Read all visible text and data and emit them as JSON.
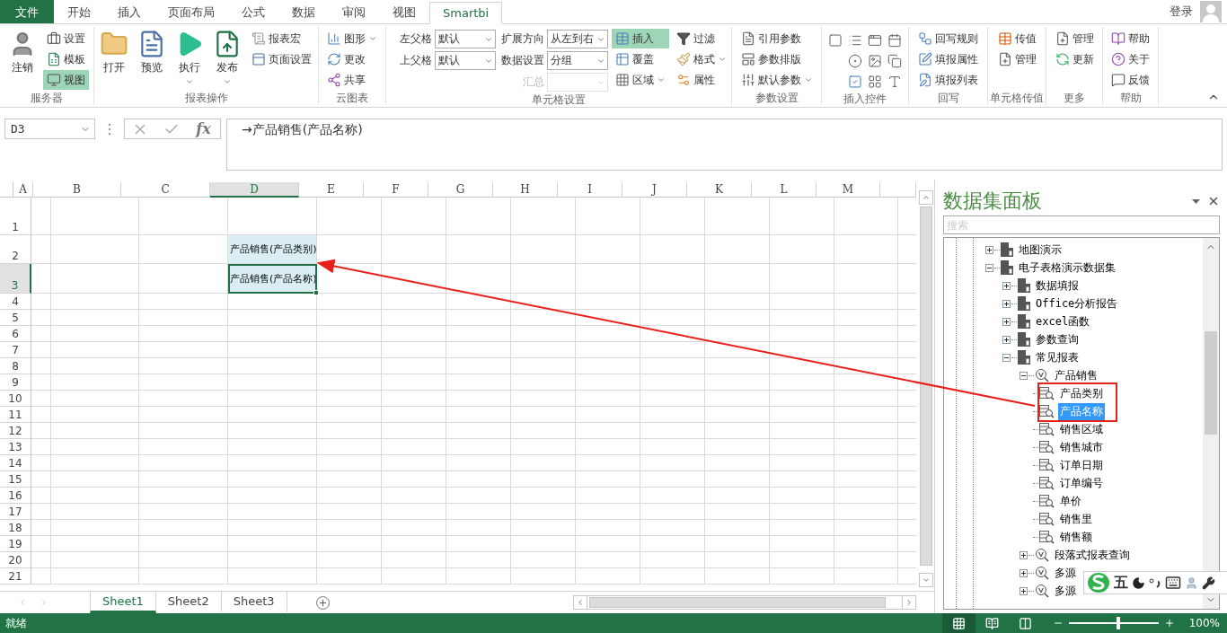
{
  "menu_tabs": [
    {
      "label": "文件",
      "kind": "file",
      "selected": false
    },
    {
      "label": "开始",
      "kind": "tab",
      "selected": false
    },
    {
      "label": "插入",
      "kind": "tab",
      "selected": false
    },
    {
      "label": "页面布局",
      "kind": "tab",
      "selected": false
    },
    {
      "label": "公式",
      "kind": "tab",
      "selected": false
    },
    {
      "label": "数据",
      "kind": "tab",
      "selected": false
    },
    {
      "label": "审阅",
      "kind": "tab",
      "selected": false
    },
    {
      "label": "视图",
      "kind": "tab",
      "selected": false
    },
    {
      "label": "Smartbi",
      "kind": "tab",
      "selected": true
    }
  ],
  "account": {
    "label": "登录"
  },
  "ribbon_groups": [
    {
      "label": "服务器",
      "items": [
        {
          "kind": "large",
          "label": "注销",
          "dropdown": false
        },
        {
          "kind": "small_column",
          "buttons": [
            {
              "label": "设置",
              "on": false,
              "dropdown": false
            },
            {
              "label": "模板",
              "on": false,
              "dropdown": false
            },
            {
              "label": "视图",
              "on": true,
              "dropdown": false
            }
          ]
        }
      ]
    },
    {
      "label": "报表操作",
      "items": [
        {
          "kind": "large",
          "label": "打开",
          "dropdown": false
        },
        {
          "kind": "large",
          "label": "预览",
          "dropdown": false
        },
        {
          "kind": "large",
          "label": "执行",
          "dropdown": true
        },
        {
          "kind": "large",
          "label": "发布",
          "dropdown": true
        },
        {
          "kind": "small_column",
          "buttons": [
            {
              "label": "报表宏",
              "on": false,
              "dropdown": false
            },
            {
              "label": "页面设置",
              "on": false,
              "dropdown": false
            }
          ]
        }
      ]
    },
    {
      "label": "云图表",
      "items": [
        {
          "kind": "small_column",
          "buttons": [
            {
              "label": "图形",
              "on": false,
              "dropdown": true
            },
            {
              "label": "更改",
              "on": false,
              "dropdown": false
            },
            {
              "label": "共享",
              "on": false,
              "dropdown": false
            }
          ]
        }
      ]
    },
    {
      "label": "单元格设置",
      "items": [
        {
          "kind": "field_column",
          "fields": [
            {
              "label": "左父格",
              "value": "默认",
              "disabled": false
            },
            {
              "label": "上父格",
              "value": "默认",
              "disabled": false
            }
          ]
        },
        {
          "kind": "field_column",
          "fields": [
            {
              "label": "扩展方向",
              "value": "从左到右",
              "disabled": false
            },
            {
              "label": "数据设置",
              "value": "分组",
              "disabled": false
            },
            {
              "label": "汇总",
              "disabled": true
            }
          ]
        },
        {
          "kind": "small_column",
          "buttons": [
            {
              "label": "插入",
              "on": true,
              "dropdown": false
            },
            {
              "label": "覆盖",
              "on": false,
              "dropdown": false
            },
            {
              "label": "区域",
              "on": false,
              "dropdown": true
            }
          ]
        },
        {
          "kind": "small_column",
          "buttons": [
            {
              "label": "过滤",
              "on": false,
              "dropdown": false
            },
            {
              "label": "格式",
              "on": false,
              "dropdown": true
            },
            {
              "label": "属性",
              "on": false,
              "dropdown": false
            }
          ]
        }
      ]
    },
    {
      "label": "参数设置",
      "items": [
        {
          "kind": "small_column",
          "buttons": [
            {
              "label": "引用参数",
              "on": false,
              "dropdown": false
            },
            {
              "label": "参数排版",
              "on": false,
              "dropdown": false
            },
            {
              "label": "默认参数",
              "on": false,
              "dropdown": true
            }
          ]
        }
      ]
    },
    {
      "label": "插入控件",
      "items": [
        {
          "kind": "icon_grid"
        }
      ]
    },
    {
      "label": "回写",
      "items": [
        {
          "kind": "small_column",
          "buttons": [
            {
              "label": "回写规则",
              "on": false,
              "dropdown": false
            },
            {
              "label": "填报属性",
              "on": false,
              "dropdown": false
            },
            {
              "label": "填报列表",
              "on": false,
              "dropdown": false
            }
          ]
        }
      ]
    },
    {
      "label": "单元格传值",
      "items": [
        {
          "kind": "small_column",
          "buttons": [
            {
              "label": "传值",
              "on": false,
              "dropdown": false
            },
            {
              "label": "管理",
              "on": false,
              "dropdown": false
            }
          ]
        }
      ]
    },
    {
      "label": "更多",
      "items": [
        {
          "kind": "small_column",
          "buttons": [
            {
              "label": "管理",
              "on": false,
              "dropdown": false
            },
            {
              "label": "更新",
              "on": false,
              "dropdown": false
            }
          ]
        }
      ]
    },
    {
      "label": "帮助",
      "items": [
        {
          "kind": "small_column",
          "buttons": [
            {
              "label": "帮助",
              "on": false,
              "dropdown": false
            },
            {
              "label": "关于",
              "on": false,
              "dropdown": false
            },
            {
              "label": "反馈",
              "on": false,
              "dropdown": false
            }
          ]
        }
      ]
    }
  ],
  "formula_bar": {
    "name_box": "D3",
    "function_button": "fx",
    "value": "→产品销售(产品名称)"
  },
  "sheet": {
    "columns": [
      {
        "label": "A",
        "selected": false
      },
      {
        "label": "B",
        "selected": false
      },
      {
        "label": "C",
        "selected": false
      },
      {
        "label": "D",
        "selected": true
      },
      {
        "label": "E",
        "selected": false
      },
      {
        "label": "F",
        "selected": false
      },
      {
        "label": "G",
        "selected": false
      },
      {
        "label": "H",
        "selected": false
      },
      {
        "label": "I",
        "selected": false
      },
      {
        "label": "J",
        "selected": false
      },
      {
        "label": "K",
        "selected": false
      },
      {
        "label": "L",
        "selected": false
      },
      {
        "label": "M",
        "selected": false
      }
    ],
    "rows": [
      {
        "label": "1",
        "selected": false
      },
      {
        "label": "2",
        "selected": false,
        "cells": [
          null,
          null,
          null,
          {
            "text": "产品销售(产品类别)",
            "bound": true,
            "selected": false
          }
        ]
      },
      {
        "label": "3",
        "selected": true,
        "cells": [
          null,
          null,
          null,
          {
            "text": "产品销售(产品名称)",
            "bound": true,
            "selected": true
          }
        ]
      },
      {
        "label": "4",
        "selected": false
      },
      {
        "label": "5",
        "selected": false
      },
      {
        "label": "6",
        "selected": false
      },
      {
        "label": "7",
        "selected": false
      },
      {
        "label": "8",
        "selected": false
      },
      {
        "label": "9",
        "selected": false
      },
      {
        "label": "10",
        "selected": false
      },
      {
        "label": "11",
        "selected": false
      },
      {
        "label": "12",
        "selected": false
      },
      {
        "label": "13",
        "selected": false
      },
      {
        "label": "14",
        "selected": false
      },
      {
        "label": "15",
        "selected": false
      },
      {
        "label": "16",
        "selected": false
      },
      {
        "label": "17",
        "selected": false
      },
      {
        "label": "18",
        "selected": false
      },
      {
        "label": "19",
        "selected": false
      },
      {
        "label": "20",
        "selected": false
      },
      {
        "label": "21",
        "selected": false
      }
    ]
  },
  "sheet_tabs": [
    {
      "label": "Sheet1",
      "selected": true
    },
    {
      "label": "Sheet2",
      "selected": false
    },
    {
      "label": "Sheet3",
      "selected": false
    }
  ],
  "dataset_panel": {
    "title": "数据集面板",
    "search": {
      "placeholder": "搜索"
    },
    "tree": [
      {
        "label": "地图演示",
        "kind": "dataset",
        "expanded": false,
        "selected": false
      },
      {
        "label": "电子表格演示数据集",
        "kind": "dataset",
        "expanded": true,
        "selected": false,
        "children": [
          {
            "label": "数据填报",
            "kind": "dataset",
            "expanded": false,
            "selected": false
          },
          {
            "label": "Office分析报告",
            "kind": "dataset",
            "expanded": false,
            "selected": false
          },
          {
            "label": "excel函数",
            "kind": "dataset",
            "expanded": false,
            "selected": false
          },
          {
            "label": "参数查询",
            "kind": "dataset",
            "expanded": false,
            "selected": false
          },
          {
            "label": "常见报表",
            "kind": "dataset",
            "expanded": true,
            "selected": false,
            "children": [
              {
                "label": "产品销售",
                "kind": "query",
                "expanded": true,
                "selected": false,
                "children": [
                  {
                    "label": "产品类别",
                    "kind": "field",
                    "selected": false
                  },
                  {
                    "label": "产品名称",
                    "kind": "field",
                    "selected": true
                  },
                  {
                    "label": "销售区域",
                    "kind": "field",
                    "selected": false
                  },
                  {
                    "label": "销售城市",
                    "kind": "field",
                    "selected": false
                  },
                  {
                    "label": "订单日期",
                    "kind": "field",
                    "selected": false
                  },
                  {
                    "label": "订单编号",
                    "kind": "field",
                    "selected": false
                  },
                  {
                    "label": "单价",
                    "kind": "field",
                    "selected": false
                  },
                  {
                    "label": "销售里",
                    "kind": "field",
                    "selected": false
                  },
                  {
                    "label": "销售额",
                    "kind": "field",
                    "selected": false
                  }
                ]
              },
              {
                "label": "段落式报表查询",
                "kind": "query",
                "expanded": false,
                "selected": false
              },
              {
                "label": "多源",
                "kind": "query",
                "expanded": false,
                "selected": false
              },
              {
                "label": "多源",
                "kind": "query",
                "expanded": false,
                "selected": false
              }
            ]
          }
        ]
      }
    ]
  },
  "ime_toolbar": {
    "mode": "五"
  },
  "status_bar": {
    "text": "就绪",
    "views": [
      {
        "kind": "normal",
        "selected": true
      },
      {
        "kind": "page_layout",
        "selected": false
      },
      {
        "kind": "page_break",
        "selected": false
      }
    ],
    "zoom": {
      "level": 0.55,
      "reading": "100%"
    }
  }
}
